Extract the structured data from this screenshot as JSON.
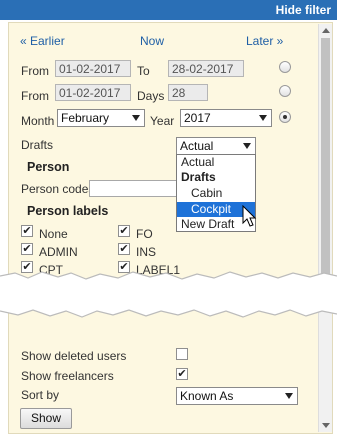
{
  "header": {
    "hide_filter": "Hide filter"
  },
  "nav": {
    "earlier": "« Earlier",
    "now": "Now",
    "later": "Later »"
  },
  "range1": {
    "from_label": "From",
    "from_value": "01-02-2017",
    "to_label": "To",
    "to_value": "28-02-2017"
  },
  "range2": {
    "from_label": "From",
    "from_value": "01-02-2017",
    "days_label": "Days",
    "days_value": "28"
  },
  "month_row": {
    "month_label": "Month",
    "month_value": "February",
    "year_label": "Year",
    "year_value": "2017"
  },
  "drafts": {
    "label": "Drafts",
    "selected": "Actual",
    "options": [
      "Actual",
      "Drafts",
      "Cabin",
      "Cockpit",
      "New Draft"
    ],
    "highlighted": "Cockpit"
  },
  "person": {
    "heading": "Person",
    "codes_label": "Person codes"
  },
  "person_labels": {
    "heading": "Person labels",
    "items": [
      {
        "label": "None",
        "checked": true
      },
      {
        "label": "FO",
        "checked": true
      },
      {
        "label": "ADMIN",
        "checked": true
      },
      {
        "label": "INS",
        "checked": true
      },
      {
        "label": "CPT",
        "checked": true
      },
      {
        "label": "LABEL1",
        "checked": true
      }
    ]
  },
  "options": {
    "show_deleted_label": "Show deleted users",
    "show_deleted_checked": false,
    "show_freelancers_label": "Show freelancers",
    "show_freelancers_checked": true,
    "sort_by_label": "Sort by",
    "sort_by_value": "Known As"
  },
  "show_button": "Show",
  "icons": {
    "check": "check-icon",
    "cursor": "mouse-pointer-icon",
    "caret": "caret-down-icon"
  }
}
